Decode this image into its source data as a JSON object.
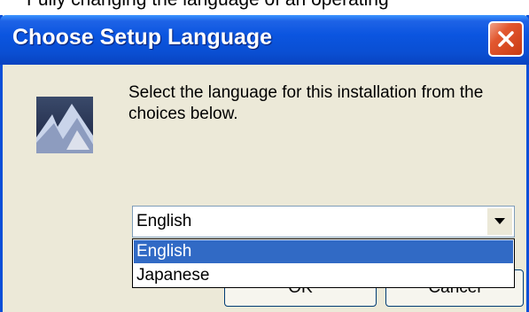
{
  "background_text": "Fully changing the language of an operating ",
  "dialog": {
    "title": "Choose Setup Language",
    "message": "Select the language for this installation from the choices below."
  },
  "language_select": {
    "selected_value": "English",
    "options": [
      "English",
      "Japanese"
    ],
    "highlighted_option": "English"
  },
  "buttons": {
    "ok_label": "OK",
    "cancel_label": "Cancel"
  },
  "icons": {
    "close": "close-icon",
    "app_logo": "setup-logo-icon",
    "dropdown_arrow": "chevron-down-icon"
  },
  "colors": {
    "titlebar": "#0a4fd8",
    "dialog_face": "#ece9d8",
    "selection": "#316ac5",
    "close_button": "#e2572f"
  }
}
